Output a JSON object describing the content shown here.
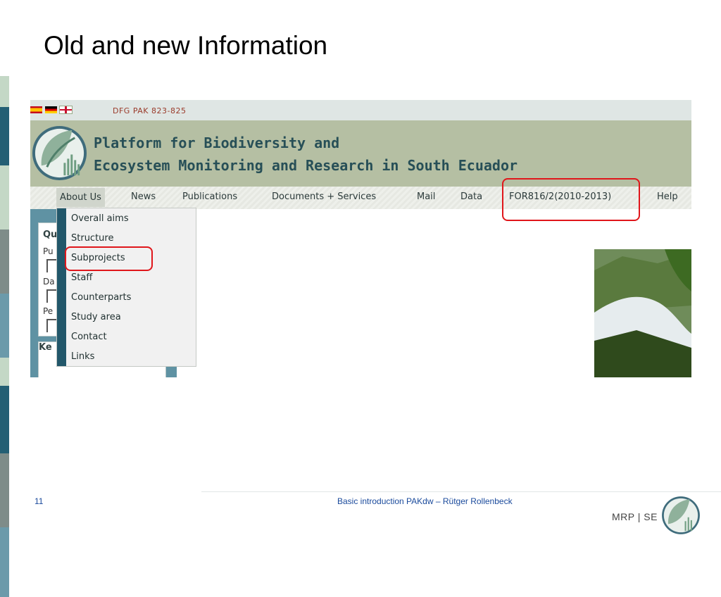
{
  "slide": {
    "title": "Old and new Information",
    "page_number": "11",
    "footer": "Basic introduction PAKdw – Rütger Rollenbeck",
    "org_label": "MRP | SE"
  },
  "side_bar_colors": [
    "#c4d8c6",
    "#245f74",
    "#c4d8c6",
    "#7e8c89",
    "#6b9aaa",
    "#c4d8c6",
    "#245f74",
    "#7e8c89",
    "#6b9aaa"
  ],
  "website": {
    "flags": [
      "flag-spain",
      "flag-germany",
      "flag-uk"
    ],
    "top_label": "DFG PAK 823-825",
    "platform_title_line1": "Platform for Biodiversity and",
    "platform_title_line2": "Ecosystem Monitoring and Research in South Ecuador",
    "nav": [
      "About Us",
      "News",
      "Publications",
      "Documents + Services",
      "Mail",
      "Data",
      "FOR816/2(2010-2013)",
      "Help"
    ],
    "dropdown": [
      "Overall aims",
      "Structure",
      "Subprojects",
      "Staff",
      "Counterparts",
      "Study area",
      "Contact",
      "Links"
    ],
    "left_panel": {
      "box1_title": "Qu",
      "box1_labels": [
        "Pu",
        "Da",
        "Pe"
      ],
      "box2_title": "Ke"
    }
  },
  "highlights": [
    "FOR816/2(2010-2013)",
    "Subprojects"
  ],
  "colors": {
    "accent_red": "#e0161b",
    "banner": "#b5bfa3",
    "title_text": "#274f57",
    "footer_text": "#1a4a9c"
  }
}
